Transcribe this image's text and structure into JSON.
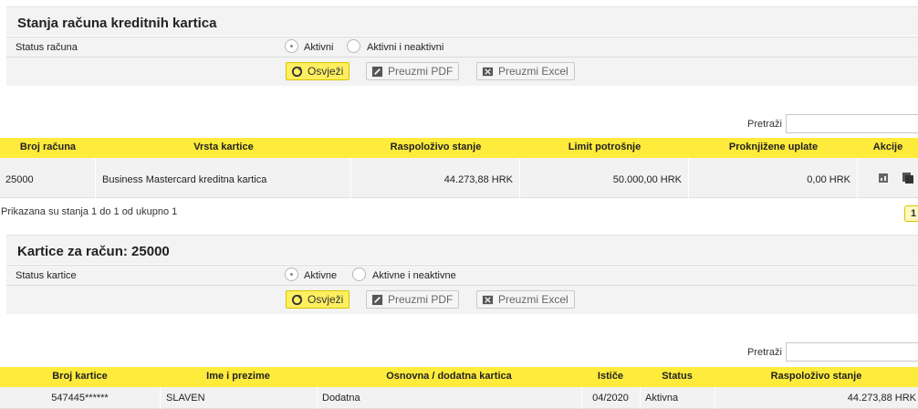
{
  "accounts_panel": {
    "title": "Stanja računa kreditnih kartica",
    "status_label": "Status računa",
    "radio_active": "Aktivni",
    "radio_all": "Aktivni i neaktivni",
    "refresh": "Osvježi",
    "pdf": "Preuzmi PDF",
    "excel": "Preuzmi Excel",
    "search_label": "Pretraži",
    "columns": [
      "Broj računa",
      "Vrsta kartice",
      "Raspoloživo stanje",
      "Limit potrošnje",
      "Proknjižene uplate",
      "Akcije"
    ],
    "rows": [
      {
        "account": "25000",
        "card_type": "Business Mastercard kreditna kartica",
        "available": "44.273,88 HRK",
        "limit": "50.000,00 HRK",
        "payments": "0,00 HRK"
      }
    ],
    "info": "Prikazana su stanja 1 do 1 od ukupno 1",
    "page": "1"
  },
  "cards_panel": {
    "title": "Kartice za račun: 25000",
    "status_label": "Status kartice",
    "radio_active": "Aktivne",
    "radio_all": "Aktivne i neaktivne",
    "refresh": "Osvježi",
    "pdf": "Preuzmi PDF",
    "excel": "Preuzmi Excel",
    "search_label": "Pretraži",
    "columns": [
      "Broj kartice",
      "Ime i prezime",
      "Osnovna / dodatna kartica",
      "Ističe",
      "Status",
      "Raspoloživo stanje"
    ],
    "rows": [
      {
        "card_number": "547445******",
        "name": "SLAVEN",
        "type": "Dodatna",
        "expires": "04/2020",
        "status": "Aktivna",
        "available": "44.273,88 HRK"
      }
    ]
  },
  "colors": {
    "accent": "#ffeb3b",
    "panel": "#f3f3f3"
  }
}
